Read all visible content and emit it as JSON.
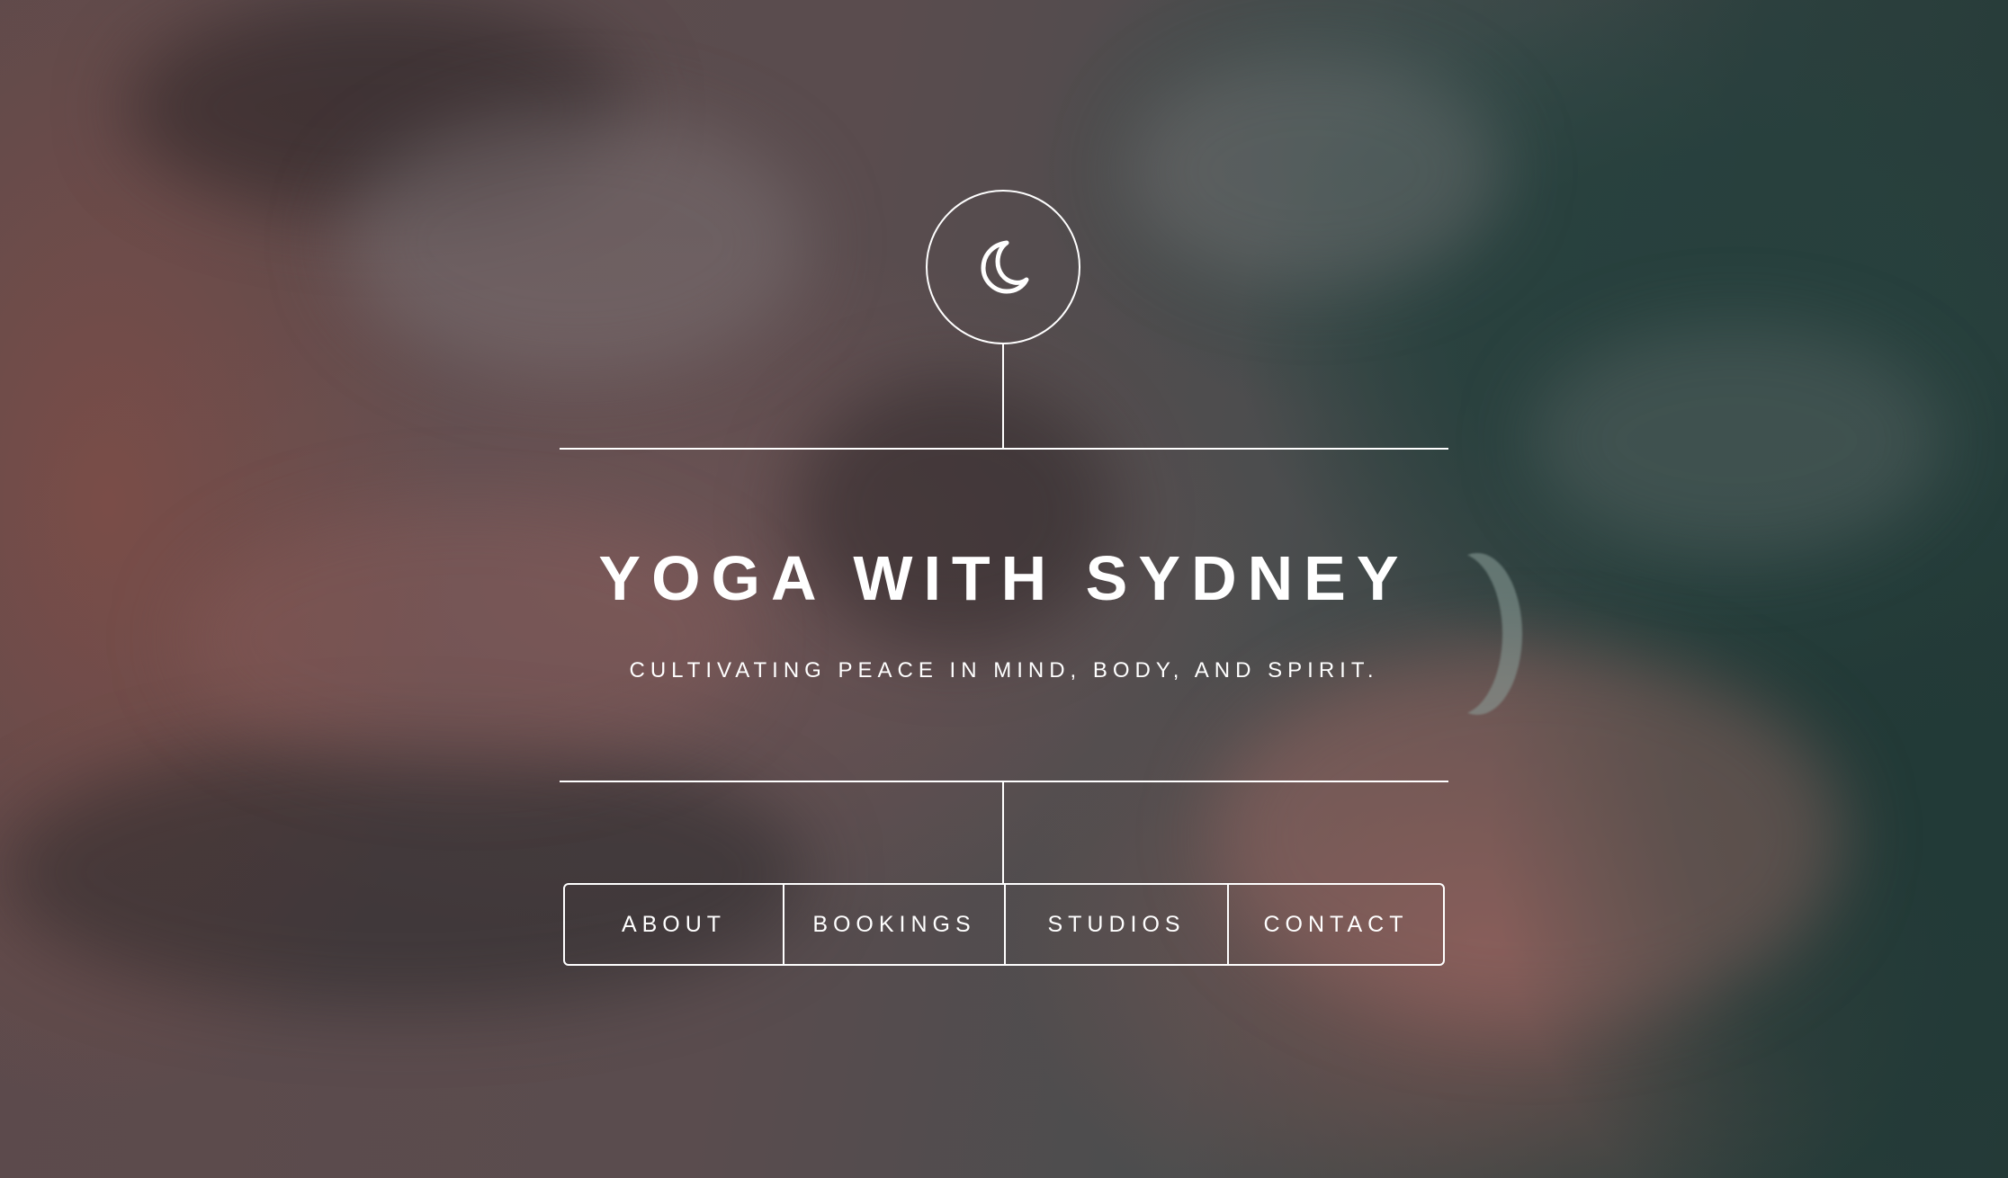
{
  "site": {
    "title": "YOGA WITH SYDNEY",
    "tagline": "CULTIVATING PEACE IN MIND, BODY, AND SPIRIT.",
    "logo_icon": "crescent-moon-icon"
  },
  "nav": {
    "items": [
      {
        "label": "ABOUT"
      },
      {
        "label": "BOOKINGS"
      },
      {
        "label": "STUDIOS"
      },
      {
        "label": "CONTACT"
      }
    ]
  },
  "colors": {
    "foreground": "#ffffff",
    "sky_teal": "#27403d",
    "cloud_pink": "#7b5552"
  }
}
